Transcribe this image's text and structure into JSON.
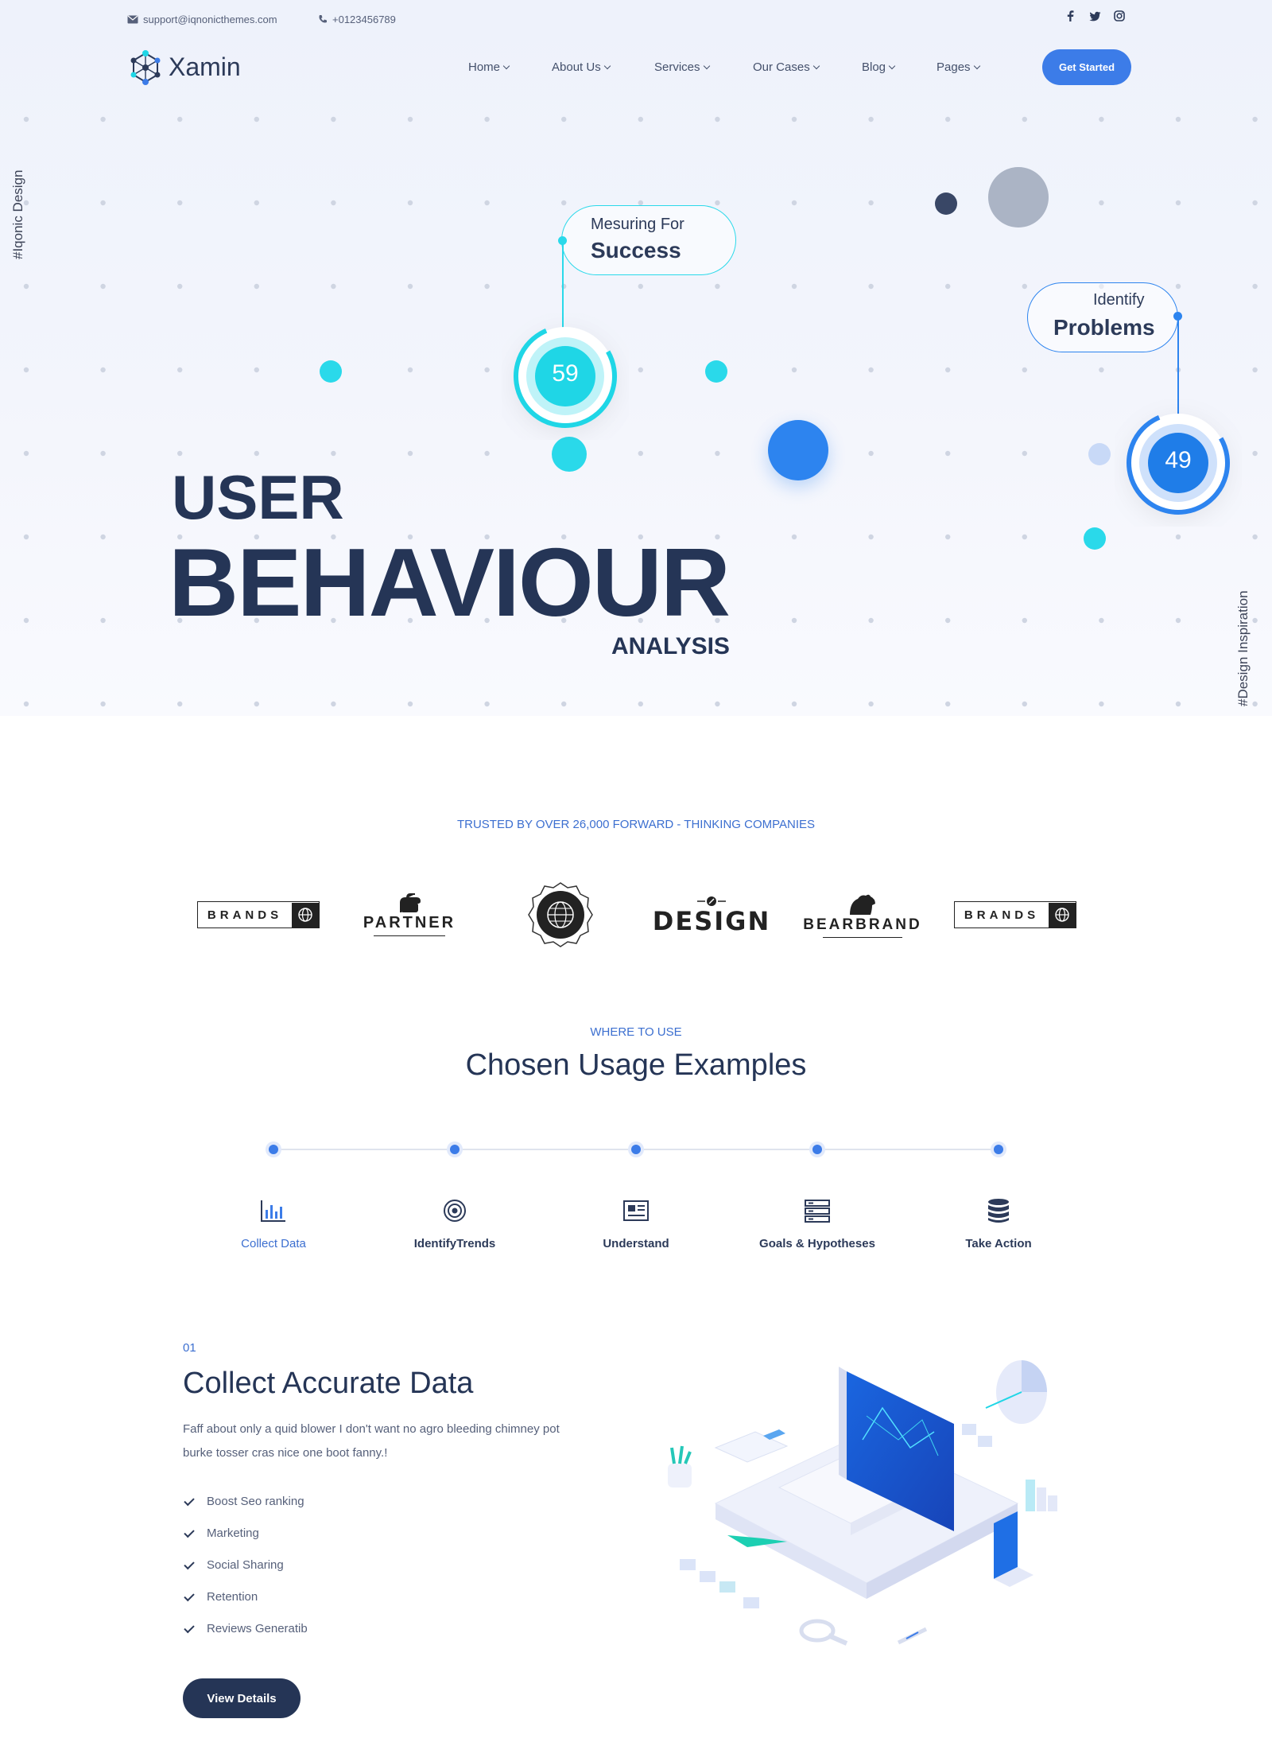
{
  "topbar": {
    "email": "support@iqnonicthemes.com",
    "phone": "+0123456789",
    "social": [
      "facebook-icon",
      "twitter-icon",
      "instagram-icon"
    ]
  },
  "brand": {
    "name": "Xamin"
  },
  "nav": [
    {
      "label": "Home"
    },
    {
      "label": "About Us"
    },
    {
      "label": "Services"
    },
    {
      "label": "Our Cases"
    },
    {
      "label": "Blog"
    },
    {
      "label": "Pages"
    }
  ],
  "cta": {
    "label": "Get Started"
  },
  "hero": {
    "side_left": "#Iqonic Design",
    "side_right": "#Design Inspiration",
    "pill1": {
      "small": "Mesuring For",
      "big": "Success"
    },
    "pill2": {
      "small": "Identify",
      "big": "Problems"
    },
    "metric1": "59",
    "metric2": "49",
    "line1": "USER",
    "line2": "BEHAVIOUR",
    "line3": "ANALYSIS"
  },
  "trusted": "TRUSTED BY OVER 26,000 FORWARD - THINKING COMPANIES",
  "logos": [
    "BRANDS",
    "PARTNER",
    "",
    "DESIGN",
    "BEARBRAND",
    "BRANDS"
  ],
  "usage": {
    "kicker": "WHERE TO USE",
    "title": "Chosen Usage Examples",
    "steps": [
      {
        "label": "Collect Data",
        "icon": "bar-chart-icon",
        "active": true
      },
      {
        "label": "IdentifyTrends",
        "icon": "target-icon",
        "active": false
      },
      {
        "label": "Understand",
        "icon": "newspaper-icon",
        "active": false
      },
      {
        "label": "Goals & Hypotheses",
        "icon": "server-icon",
        "active": false
      },
      {
        "label": "Take Action",
        "icon": "database-icon",
        "active": false
      }
    ]
  },
  "collect": {
    "number": "01",
    "title": "Collect Accurate Data",
    "text1": "Faff about only a quid blower I don't want no agro bleeding chimney pot",
    "text2": "burke tosser cras nice one boot fanny.!",
    "items": [
      "Boost Seo ranking",
      "Marketing",
      "Social Sharing",
      "Retention",
      "Reviews Generatib"
    ],
    "button": "View Details"
  },
  "colors": {
    "accent": "#3c7ce8",
    "cyan": "#1fd6e6",
    "navy": "#253556"
  }
}
